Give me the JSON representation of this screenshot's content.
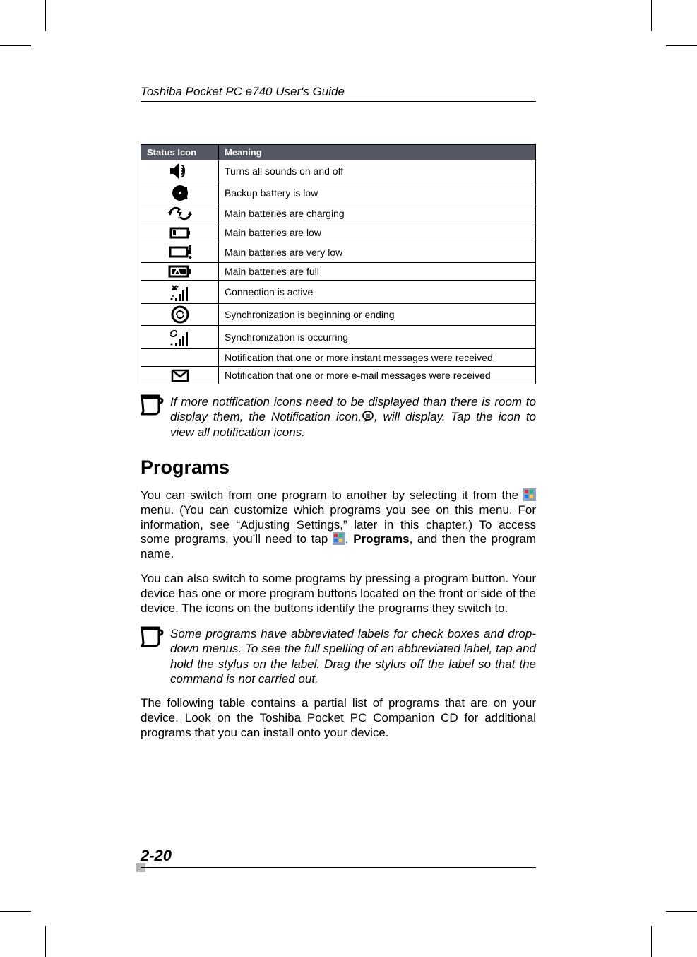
{
  "runningHeader": "Toshiba Pocket PC e740  User's Guide",
  "table": {
    "headers": [
      "Status Icon",
      "Meaning"
    ],
    "rows": [
      {
        "iconName": "sound-toggle-icon",
        "meaning": "Turns all sounds on and off"
      },
      {
        "iconName": "backup-battery-low-icon",
        "meaning": "Backup battery is low"
      },
      {
        "iconName": "batteries-charging-icon",
        "meaning": "Main batteries are charging"
      },
      {
        "iconName": "batteries-low-icon",
        "meaning": "Main batteries are low"
      },
      {
        "iconName": "batteries-very-low-icon",
        "meaning": "Main batteries are very low"
      },
      {
        "iconName": "batteries-full-icon",
        "meaning": "Main batteries are full"
      },
      {
        "iconName": "connection-active-icon",
        "meaning": "Connection is active"
      },
      {
        "iconName": "sync-begin-end-icon",
        "meaning": "Synchronization is beginning or ending"
      },
      {
        "iconName": "sync-occurring-icon",
        "meaning": "Synchronization is occurring"
      },
      {
        "iconName": "im-received-icon",
        "meaning": "Notification that one or more instant messages were received"
      },
      {
        "iconName": "email-received-icon",
        "meaning": "Notification that one or more e-mail messages were received"
      }
    ]
  },
  "note1": {
    "prefix": "If more notification icons need to be displayed than there is room to display them, the Notification icon,",
    "iconName": "notification-overflow-icon",
    "suffix": ", will display. Tap the icon to view all notification icons."
  },
  "heading": "Programs",
  "para1": {
    "seg1": "You can switch from one program to another by selecting it from the ",
    "icon1Name": "start-menu-icon",
    "seg2": " menu. (You can customize which programs you see on this menu. For information, see “Adjusting Settings,” later in this chapter.) To access some programs, you’ll need to tap ",
    "icon2Name": "start-menu-icon",
    "seg3": ",  ",
    "boldWord": "Programs",
    "seg4": ", and then the program name."
  },
  "para2": "You can also switch to some programs by pressing a program button. Your device has one or more program buttons located on the front or side of the device. The icons on the buttons identify the programs they switch to.",
  "note2": "Some programs have abbreviated labels for check boxes and drop-down menus. To see the full spelling of an  abbreviated label, tap and hold the stylus on the label. Drag the stylus off the label so that the command is not carried out.",
  "para3": "The following table contains a partial list of programs that are on your device. Look on the Toshiba Pocket PC Companion CD for additional programs that you can install onto your device.",
  "pageNumber": "2-20"
}
